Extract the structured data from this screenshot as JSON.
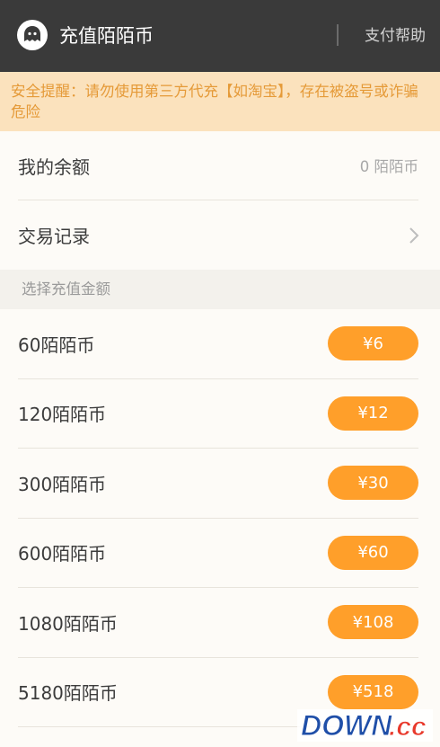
{
  "header": {
    "title": "充值陌陌币",
    "help_label": "支付帮助"
  },
  "warning": {
    "text": "安全提醒：请勿使用第三方代充【如淘宝】，存在被盗号或诈骗危险"
  },
  "balance": {
    "label": "我的余额",
    "value": "0 陌陌币"
  },
  "records": {
    "label": "交易记录"
  },
  "section": {
    "title": "选择充值金额"
  },
  "packages": [
    {
      "label": "60陌陌币",
      "price": "¥6"
    },
    {
      "label": "120陌陌币",
      "price": "¥12"
    },
    {
      "label": "300陌陌币",
      "price": "¥30"
    },
    {
      "label": "600陌陌币",
      "price": "¥60"
    },
    {
      "label": "1080陌陌币",
      "price": "¥108"
    },
    {
      "label": "5180陌陌币",
      "price": "¥518"
    }
  ],
  "watermark": {
    "text_main": "DOWN",
    "text_suffix": ".cc"
  },
  "colors": {
    "header_bg": "#3a3a3a",
    "warning_bg": "#fbe2bd",
    "warning_text": "#e59a38",
    "accent": "#ff9f2a"
  }
}
